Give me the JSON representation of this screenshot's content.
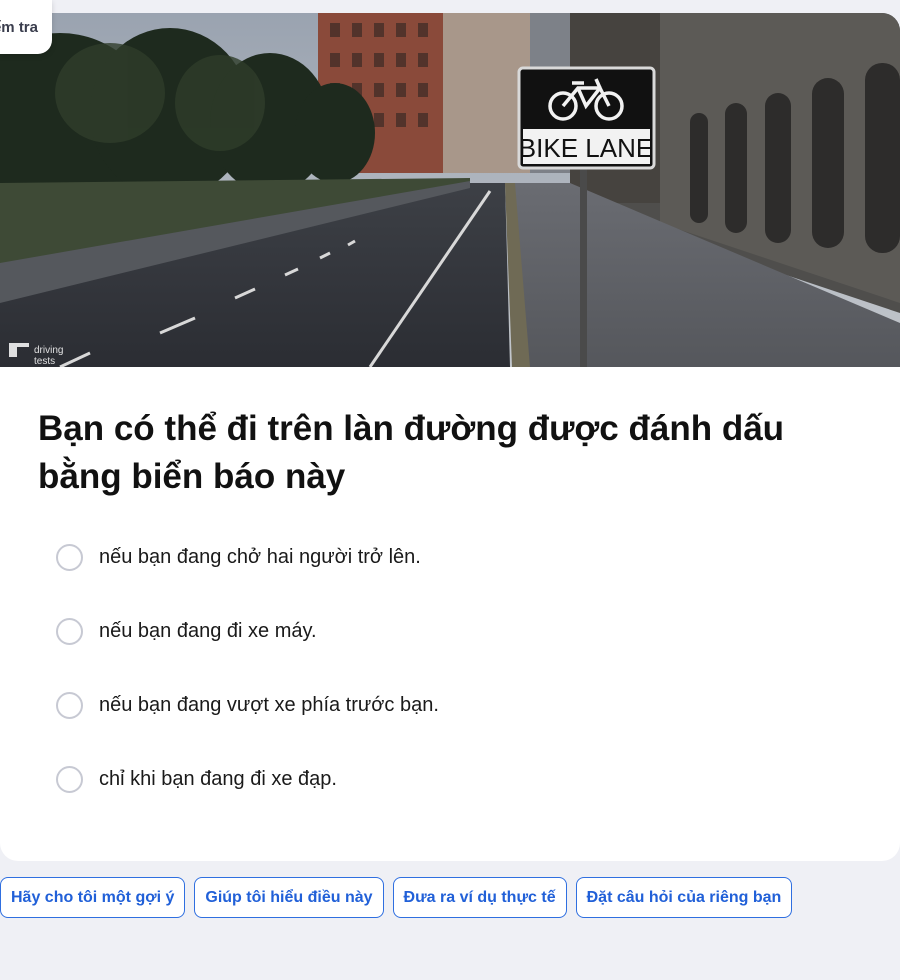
{
  "header": {
    "check_label": "Kiểm tra"
  },
  "scene": {
    "sign_text": "BIKE LANE",
    "watermark_line1": "driving",
    "watermark_line2": "tests"
  },
  "question": {
    "text": "Bạn có thể đi trên làn đường được đánh dấu bằng biển báo này"
  },
  "options": [
    {
      "label": "nếu bạn đang chở hai người trở lên."
    },
    {
      "label": "nếu bạn đang đi xe máy."
    },
    {
      "label": "nếu bạn đang vượt xe phía trước bạn."
    },
    {
      "label": "chỉ khi bạn đang đi xe đạp."
    }
  ],
  "help_chips": [
    {
      "label": "Hãy cho tôi một gợi ý"
    },
    {
      "label": "Giúp tôi hiểu điều này"
    },
    {
      "label": "Đưa ra ví dụ thực tế"
    },
    {
      "label": "Đặt câu hỏi của riêng bạn"
    }
  ],
  "colors": {
    "accent": "#2160d8",
    "page_bg": "#eff0f5"
  }
}
